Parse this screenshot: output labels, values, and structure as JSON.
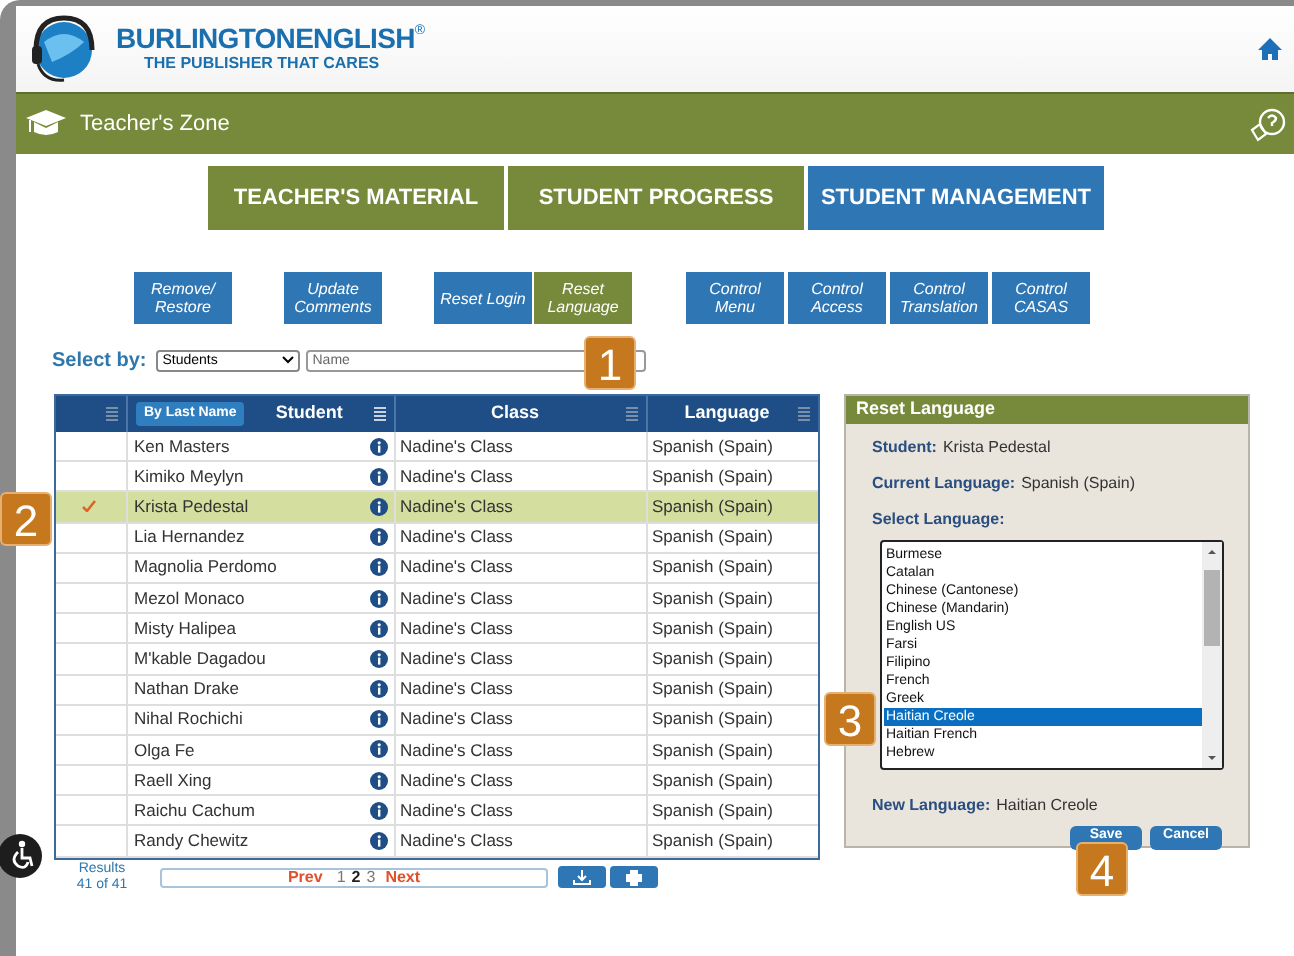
{
  "header": {
    "brand": "BURLINGTONENGLISH",
    "registered": "®",
    "tagline": "THE PUBLISHER THAT CARES"
  },
  "zone_bar": {
    "title": "Teacher's Zone"
  },
  "main_tabs": [
    {
      "label": "TEACHER'S MATERIAL",
      "selected": false
    },
    {
      "label": "STUDENT PROGRESS",
      "selected": false
    },
    {
      "label": "STUDENT MANAGEMENT",
      "selected": true
    }
  ],
  "action_buttons": [
    {
      "label": "Remove/ Restore",
      "selected": false
    },
    {
      "label": "Update Comments",
      "selected": false
    },
    {
      "label": "Reset Login",
      "selected": false
    },
    {
      "label": "Reset Language",
      "selected": true
    },
    {
      "label": "Control Menu",
      "selected": false
    },
    {
      "label": "Control Access",
      "selected": false
    },
    {
      "label": "Control Translation",
      "selected": false
    },
    {
      "label": "Control CASAS",
      "selected": false
    }
  ],
  "select_by": {
    "label": "Select by:",
    "dropdown": "Students",
    "placeholder": "Name"
  },
  "table": {
    "sort_button": "By Last Name",
    "columns": [
      "Student",
      "Class",
      "Language"
    ],
    "rows": [
      {
        "student": "Ken Masters",
        "class": "Nadine's Class",
        "language": "Spanish (Spain)",
        "selected": false
      },
      {
        "student": "Kimiko Meylyn",
        "class": "Nadine's Class",
        "language": "Spanish (Spain)",
        "selected": false
      },
      {
        "student": "Krista Pedestal",
        "class": "Nadine's Class",
        "language": "Spanish (Spain)",
        "selected": true
      },
      {
        "student": "Lia Hernandez",
        "class": "Nadine's Class",
        "language": "Spanish (Spain)",
        "selected": false
      },
      {
        "student": "Magnolia Perdomo",
        "class": "Nadine's Class",
        "language": "Spanish (Spain)",
        "selected": false
      },
      {
        "student": "Mezol Monaco",
        "class": "Nadine's Class",
        "language": "Spanish (Spain)",
        "selected": false
      },
      {
        "student": "Misty Halipea",
        "class": "Nadine's Class",
        "language": "Spanish (Spain)",
        "selected": false
      },
      {
        "student": "M'kable Dagadou",
        "class": "Nadine's Class",
        "language": "Spanish (Spain)",
        "selected": false
      },
      {
        "student": "Nathan Drake",
        "class": "Nadine's Class",
        "language": "Spanish (Spain)",
        "selected": false
      },
      {
        "student": "Nihal Rochichi",
        "class": "Nadine's Class",
        "language": "Spanish (Spain)",
        "selected": false
      },
      {
        "student": "Olga Fe",
        "class": "Nadine's Class",
        "language": "Spanish (Spain)",
        "selected": false
      },
      {
        "student": "Raell Xing",
        "class": "Nadine's Class",
        "language": "Spanish (Spain)",
        "selected": false
      },
      {
        "student": "Raichu Cachum",
        "class": "Nadine's Class",
        "language": "Spanish (Spain)",
        "selected": false
      },
      {
        "student": "Randy Chewitz",
        "class": "Nadine's Class",
        "language": "Spanish (Spain)",
        "selected": false
      }
    ]
  },
  "results": {
    "label": "Results",
    "count": "41 of 41"
  },
  "pager": {
    "prev": "Prev",
    "next": "Next",
    "pages": [
      {
        "label": "1",
        "selected": false
      },
      {
        "label": "2",
        "selected": true
      },
      {
        "label": "3",
        "selected": false
      }
    ]
  },
  "panel": {
    "title": "Reset Language",
    "fields": [
      {
        "label": "Student:",
        "value": "Krista Pedestal"
      },
      {
        "label": "Current Language:",
        "value": "Spanish (Spain)"
      }
    ],
    "select_label": "Select Language:",
    "languages": [
      {
        "label": "Burmese",
        "selected": false
      },
      {
        "label": "Catalan",
        "selected": false
      },
      {
        "label": "Chinese (Cantonese)",
        "selected": false
      },
      {
        "label": "Chinese (Mandarin)",
        "selected": false
      },
      {
        "label": "English US",
        "selected": false
      },
      {
        "label": "Farsi",
        "selected": false
      },
      {
        "label": "Filipino",
        "selected": false
      },
      {
        "label": "French",
        "selected": false
      },
      {
        "label": "Greek",
        "selected": false
      },
      {
        "label": "Haitian Creole",
        "selected": true
      },
      {
        "label": "Haitian French",
        "selected": false
      },
      {
        "label": "Hebrew",
        "selected": false
      }
    ],
    "new_language": {
      "label": "New Language:",
      "value": "Haitian Creole"
    },
    "buttons": [
      "Save",
      "Cancel"
    ]
  },
  "step_badges": [
    "1",
    "2",
    "3",
    "4"
  ]
}
